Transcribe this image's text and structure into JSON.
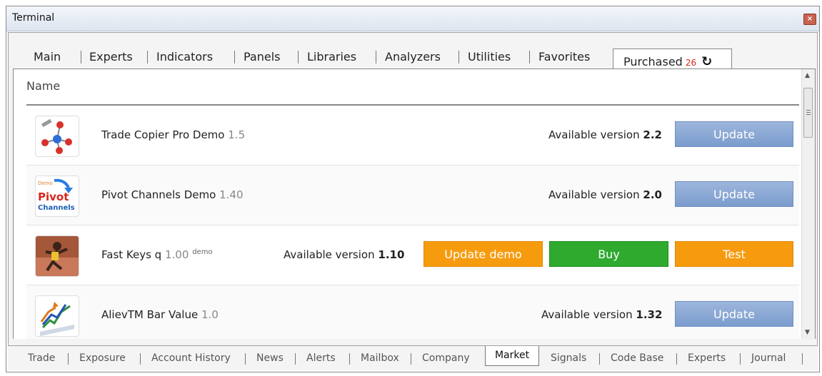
{
  "window": {
    "title": "Terminal",
    "close_icon": "close-icon"
  },
  "tabs": [
    {
      "label": "Main"
    },
    {
      "label": "Experts"
    },
    {
      "label": "Indicators"
    },
    {
      "label": "Panels"
    },
    {
      "label": "Libraries"
    },
    {
      "label": "Analyzers"
    },
    {
      "label": "Utilities"
    },
    {
      "label": "Favorites"
    }
  ],
  "active_tab": {
    "label": "Purchased",
    "badge": "26",
    "refresh_icon": "↻"
  },
  "list": {
    "column_header": "Name",
    "rows": [
      {
        "name": "Trade Copier Pro Demo",
        "version": "1.5",
        "available_label": "Available version",
        "available_version": "2.2",
        "button": "Update",
        "icon": "trade-copier-icon"
      },
      {
        "name": "Pivot Channels Demo",
        "version": "1.40",
        "available_label": "Available version",
        "available_version": "2.0",
        "button": "Update",
        "icon": "pivot-channels-icon",
        "icon_text_1": "Pivot",
        "icon_text_2": "Channels",
        "icon_text_3": "Demo"
      },
      {
        "name": "Fast Keys q",
        "version": "1.00",
        "tag": "demo",
        "available_label": "Available version",
        "available_version": "1.10",
        "buttons": [
          "Update demo",
          "Buy",
          "Test"
        ],
        "icon": "runner-icon"
      },
      {
        "name": "AlievTM Bar Value",
        "version": "1.0",
        "available_label": "Available version",
        "available_version": "1.32",
        "button": "Update",
        "icon": "bar-value-icon"
      }
    ]
  },
  "bottom_tabs": [
    "Trade",
    "Exposure",
    "Account History",
    "News",
    "Alerts",
    "Mailbox",
    "Company",
    "Market",
    "Signals",
    "Code Base",
    "Experts",
    "Journal"
  ],
  "active_bottom_tab": "Market",
  "colors": {
    "update_button": "#7b9ccd",
    "orange_button": "#f79b0e",
    "green_button": "#2faa2f",
    "badge": "#d9261c"
  }
}
